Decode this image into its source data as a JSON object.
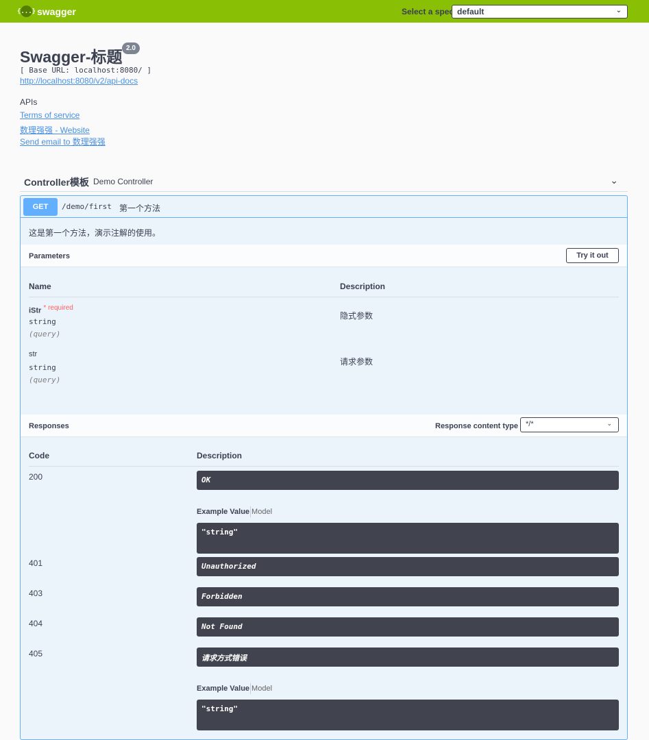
{
  "topbar": {
    "logo_text": "swagger",
    "logo_glyph": "{...}",
    "spec_label": "Select a spec",
    "spec_value": "default"
  },
  "info": {
    "title": "Swagger-标题",
    "version": "2.0",
    "base_url": "[ Base URL: localhost:8080/ ]",
    "docs_link": "http://localhost:8080/v2/api-docs",
    "description": "APIs",
    "terms": "Terms of service",
    "website": "数理强强 - Website",
    "email": "Send email to 数理强强"
  },
  "tag": {
    "name": "Controller模板",
    "description": "Demo Controller"
  },
  "operation": {
    "method": "GET",
    "path": "/demo/first",
    "summary": "第一个方法",
    "description": "这是第一个方法，演示注解的使用。"
  },
  "parameters": {
    "title": "Parameters",
    "try_label": "Try it out",
    "col_name": "Name",
    "col_desc": "Description",
    "items": [
      {
        "name": "iStr",
        "required_mark": "* required",
        "type": "string",
        "in": "(query)",
        "description": "隐式参数"
      },
      {
        "name": "str",
        "type": "string",
        "in": "(query)",
        "description": "请求参数"
      }
    ]
  },
  "responses": {
    "title": "Responses",
    "content_type_label": "Response content type",
    "content_type_value": "*/*",
    "col_code": "Code",
    "col_desc": "Description",
    "example_value_label": "Example Value",
    "model_label": "Model",
    "items": [
      {
        "code": "200",
        "description": "OK",
        "example": "\"string\""
      },
      {
        "code": "401",
        "description": "Unauthorized"
      },
      {
        "code": "403",
        "description": "Forbidden"
      },
      {
        "code": "404",
        "description": "Not Found"
      },
      {
        "code": "405",
        "description": "请求方式错误",
        "example": "\"string\""
      }
    ]
  },
  "colors": {
    "topbar": "#89bf04",
    "get": "#61affe",
    "dark_box": "#41444e",
    "required": "#ff6060"
  },
  "icons": {
    "logo": "swagger-logo-icon",
    "chevron": "chevron-down-icon"
  }
}
